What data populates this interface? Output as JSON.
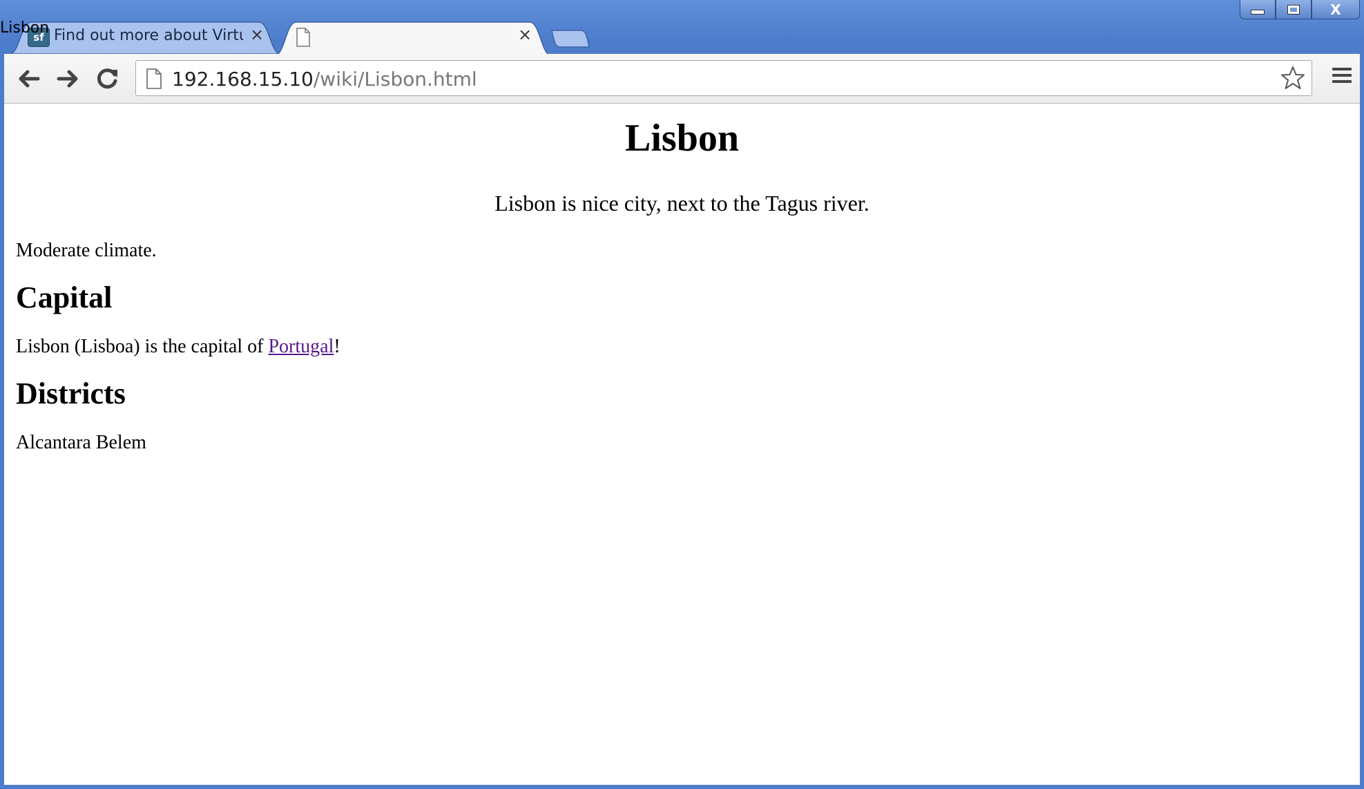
{
  "window": {
    "controls": {
      "minimize": "minimize",
      "maximize": "maximize",
      "close": "close"
    }
  },
  "tabs": [
    {
      "title": "Find out more about Virtu",
      "favicon": "sf",
      "active": false,
      "close": "×"
    },
    {
      "title": "Lisbon",
      "favicon": "document-icon",
      "active": true,
      "close": "×"
    }
  ],
  "toolbar": {
    "url_host": "192.168.15.10",
    "url_path": "/wiki/Lisbon.html"
  },
  "page": {
    "title": "Lisbon",
    "lead": "Lisbon is nice city, next to the Tagus river.",
    "climate": "Moderate climate.",
    "capital_heading": "Capital",
    "capital_text_before": "Lisbon (Lisboa) is the capital of ",
    "capital_link": "Portugal",
    "capital_text_after": "!",
    "districts_heading": "Districts",
    "districts_text": "Alcantara Belem"
  },
  "colors": {
    "link_visited": "#551a8b",
    "frame": "#4d7ccb"
  }
}
